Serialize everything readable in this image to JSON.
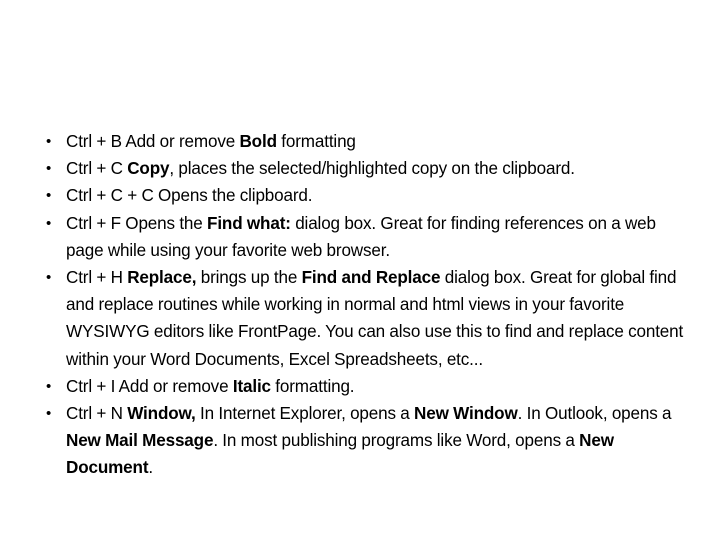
{
  "slide": {
    "background_color": "#ffffff",
    "text_color": "#000000",
    "bullet_glyph": "•",
    "title": "",
    "items": [
      {
        "id": "ctrl-b",
        "shortcut": "Ctrl + B",
        "runs": [
          {
            "text": "Ctrl + B Add or remove ",
            "bold": false
          },
          {
            "text": "Bold",
            "bold": true
          },
          {
            "text": " formatting",
            "bold": false
          }
        ],
        "plain": "Ctrl + B Add or remove Bold formatting"
      },
      {
        "id": "ctrl-c",
        "shortcut": "Ctrl + C",
        "runs": [
          {
            "text": "Ctrl + C ",
            "bold": false
          },
          {
            "text": "Copy",
            "bold": true
          },
          {
            "text": ", places the selected/highlighted copy on the clipboard.",
            "bold": false
          }
        ],
        "plain": "Ctrl + C Copy, places the selected/highlighted copy on the clipboard."
      },
      {
        "id": "ctrl-c-c",
        "shortcut": "Ctrl + C + C",
        "runs": [
          {
            "text": "Ctrl + C + C Opens the clipboard.",
            "bold": false
          }
        ],
        "plain": "Ctrl + C + C Opens the clipboard."
      },
      {
        "id": "ctrl-f",
        "shortcut": "Ctrl + F",
        "runs": [
          {
            "text": "Ctrl + F Opens the ",
            "bold": false
          },
          {
            "text": "Find what:",
            "bold": true
          },
          {
            "text": " dialog box. Great for finding references on a web page while using your favorite web browser.",
            "bold": false
          }
        ],
        "plain": "Ctrl + F Opens the Find what: dialog box. Great for finding references on a web page while using your favorite web browser."
      },
      {
        "id": "ctrl-h",
        "shortcut": "Ctrl + H",
        "runs": [
          {
            "text": "Ctrl + H ",
            "bold": false
          },
          {
            "text": "Replace,",
            "bold": true
          },
          {
            "text": " brings up the ",
            "bold": false
          },
          {
            "text": "Find and Replace",
            "bold": true
          },
          {
            "text": " dialog box. Great for global find and replace routines while working in normal and html views in your favorite WYSIWYG editors like FrontPage. You can also use this to find and replace content within your Word Documents, Excel Spreadsheets, etc...",
            "bold": false
          }
        ],
        "plain": "Ctrl + H Replace, brings up the Find and Replace dialog box. Great for global find and replace routines while working in normal and html views in your favorite WYSIWYG editors like FrontPage. You can also use this to find and replace content within your Word Documents, Excel Spreadsheets, etc..."
      },
      {
        "id": "ctrl-i",
        "shortcut": "Ctrl + I",
        "runs": [
          {
            "text": "Ctrl + I Add or remove ",
            "bold": false
          },
          {
            "text": "Italic",
            "bold": true
          },
          {
            "text": " formatting.",
            "bold": false
          }
        ],
        "plain": "Ctrl + I Add or remove Italic formatting."
      },
      {
        "id": "ctrl-n",
        "shortcut": "Ctrl + N",
        "runs": [
          {
            "text": "Ctrl + N ",
            "bold": false
          },
          {
            "text": "Window,",
            "bold": true
          },
          {
            "text": " In Internet Explorer, opens a ",
            "bold": false
          },
          {
            "text": "New Window",
            "bold": true
          },
          {
            "text": ". In Outlook, opens a ",
            "bold": false
          },
          {
            "text": "New Mail Message",
            "bold": true
          },
          {
            "text": ". In most publishing programs like Word, opens a ",
            "bold": false
          },
          {
            "text": "New Document",
            "bold": true
          },
          {
            "text": ".",
            "bold": false
          }
        ],
        "plain": "Ctrl + N Window, In Internet Explorer, opens a New Window. In Outlook, opens a New Mail Message. In most publishing programs like Word, opens a New Document."
      }
    ]
  }
}
